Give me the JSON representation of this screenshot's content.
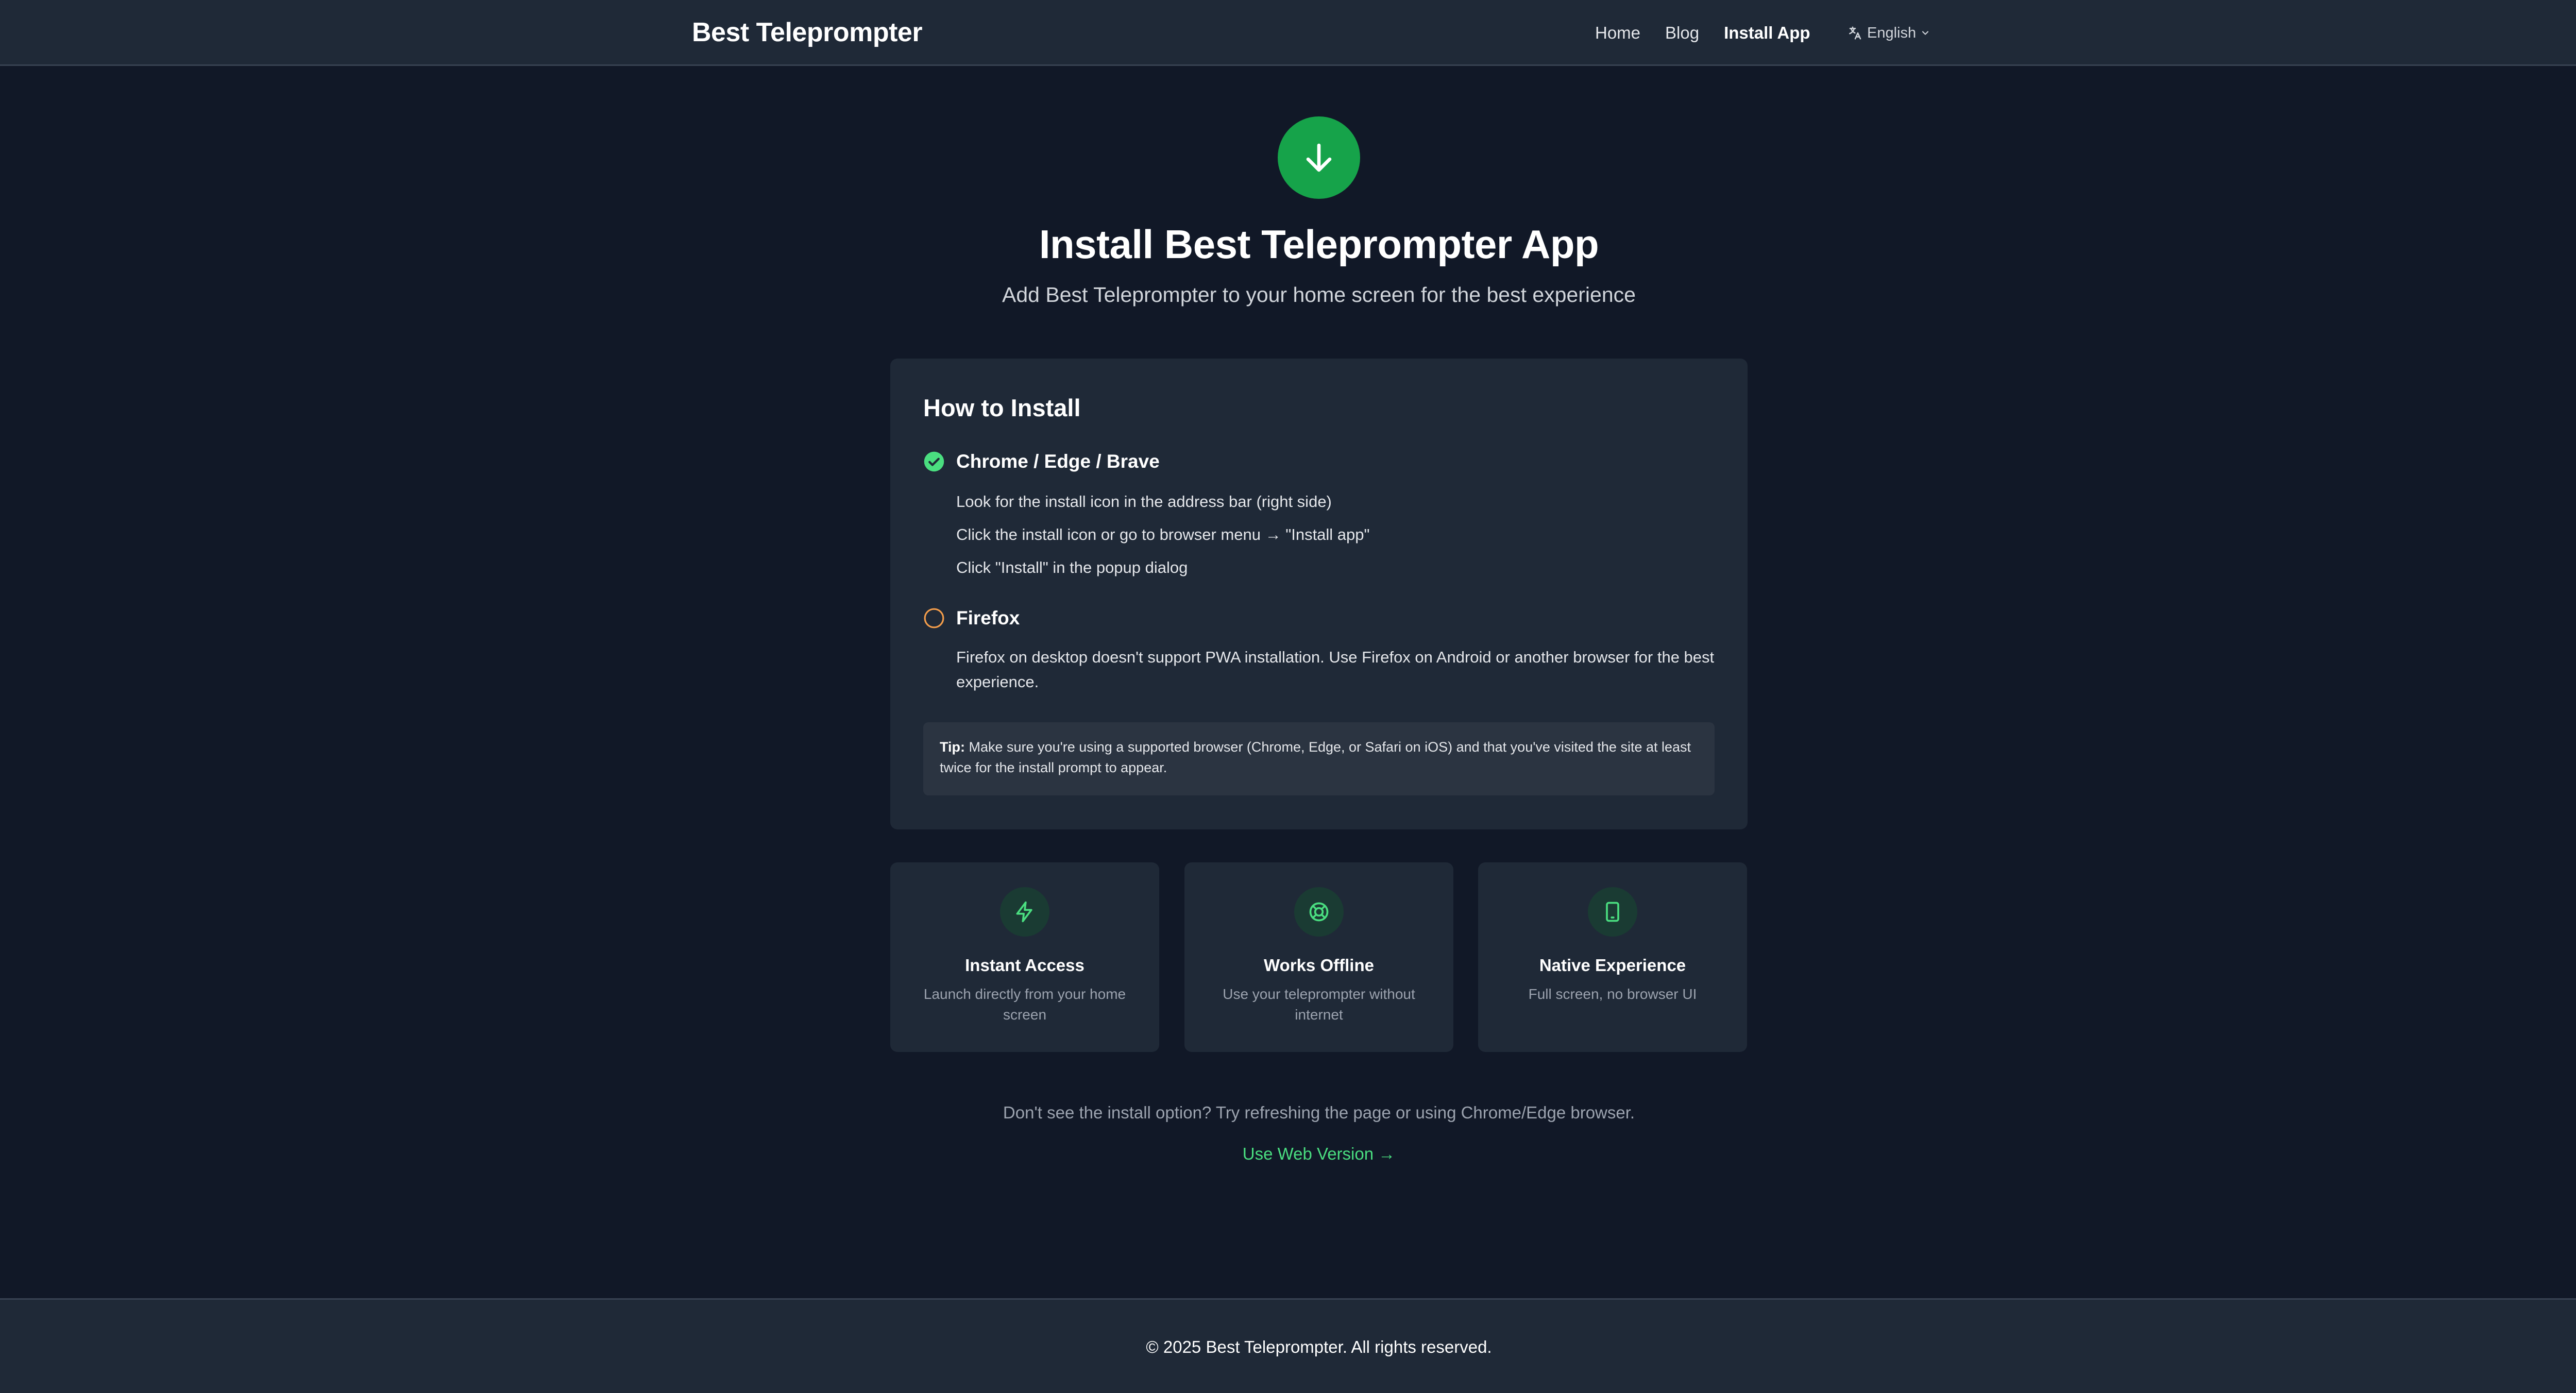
{
  "header": {
    "brand": "Best Teleprompter",
    "nav": [
      {
        "label": "Home"
      },
      {
        "label": "Blog"
      },
      {
        "label": "Install App"
      }
    ],
    "language": "English"
  },
  "hero": {
    "icon": "download-arrow-icon",
    "title": "Install Best Teleprompter App",
    "subtitle": "Add Best Teleprompter to your home screen for the best experience"
  },
  "how_to": {
    "heading": "How to Install",
    "chrome": {
      "title": "Chrome / Edge / Brave",
      "icon": "check-circle-icon",
      "steps": [
        "Look for the install icon in the address bar (right side)",
        "Click the install icon or go to browser menu → \"Install app\"",
        "Click \"Install\" in the popup dialog"
      ]
    },
    "firefox": {
      "title": "Firefox",
      "icon": "circle-outline-icon",
      "text": "Firefox on desktop doesn't support PWA installation. Use Firefox on Android or another browser for the best experience."
    },
    "tip_label": "Tip:",
    "tip_text": " Make sure you're using a supported browser (Chrome, Edge, or Safari on iOS) and that you've visited the site at least twice for the install prompt to appear."
  },
  "features": [
    {
      "icon": "lightning-icon",
      "title": "Instant Access",
      "desc": "Launch directly from your home screen"
    },
    {
      "icon": "lifebuoy-icon",
      "title": "Works Offline",
      "desc": "Use your teleprompter without internet"
    },
    {
      "icon": "smartphone-icon",
      "title": "Native Experience",
      "desc": "Full screen, no browser UI"
    }
  ],
  "bottom": {
    "hint": "Don't see the install option? Try refreshing the page or using Chrome/Edge browser.",
    "web_link": "Use Web Version →"
  },
  "footer": {
    "copyright": "© 2025 Best Teleprompter. All rights reserved."
  },
  "colors": {
    "background": "#111827",
    "surface": "#1f2937",
    "accent_green": "#16a34a",
    "link_green": "#4ade80",
    "warning_orange": "#f59e4b"
  }
}
